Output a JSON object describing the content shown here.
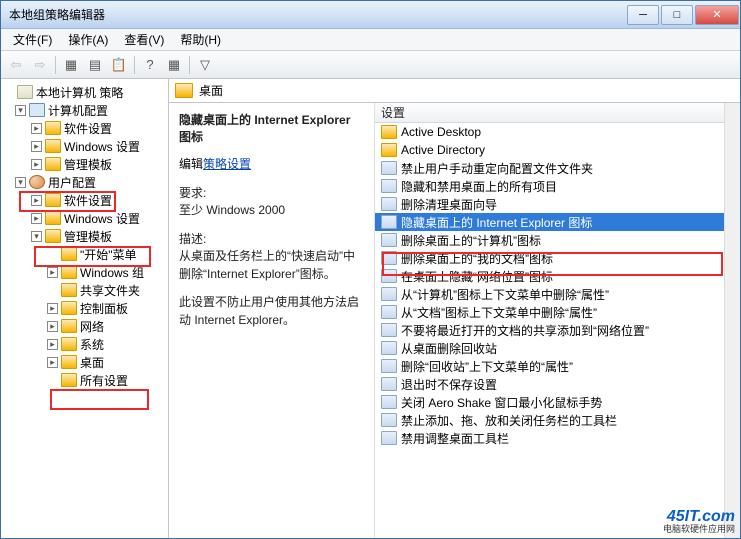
{
  "window": {
    "title": "本地组策略编辑器"
  },
  "menu": {
    "file": "文件(F)",
    "action": "操作(A)",
    "view": "查看(V)",
    "help": "帮助(H)"
  },
  "tree": {
    "root": "本地计算机 策略",
    "comp": "计算机配置",
    "comp_sw": "软件设置",
    "comp_win": "Windows 设置",
    "comp_admin": "管理模板",
    "user": "用户配置",
    "user_sw": "软件设置",
    "user_win": "Windows 设置",
    "user_admin": "管理模板",
    "start_menu": "\"开始\"菜单",
    "win_comp": "Windows 组",
    "shared": "共享文件夹",
    "ctrl_panel": "控制面板",
    "network": "网络",
    "system": "系统",
    "desktop": "桌面",
    "all": "所有设置"
  },
  "content": {
    "header": "桌面",
    "heading": "隐藏桌面上的 Internet Explorer 图标",
    "edit": "编辑",
    "policy_link": "策略设置",
    "req_label": "要求:",
    "req_val": "至少 Windows 2000",
    "desc_label": "描述:",
    "desc_1": "从桌面及任务栏上的“快速启动”中删除“Internet Explorer”图标。",
    "desc_2": "此设置不防止用户使用其他方法启动 Internet Explorer。"
  },
  "list": {
    "col": "设置",
    "items": [
      {
        "label": "Active Desktop",
        "type": "folder"
      },
      {
        "label": "Active Directory",
        "type": "folder"
      },
      {
        "label": "禁止用户手动重定向配置文件文件夹",
        "type": "setting"
      },
      {
        "label": "隐藏和禁用桌面上的所有项目",
        "type": "setting"
      },
      {
        "label": "删除清理桌面向导",
        "type": "setting"
      },
      {
        "label": "隐藏桌面上的 Internet Explorer 图标",
        "type": "setting",
        "selected": true
      },
      {
        "label": "删除桌面上的“计算机”图标",
        "type": "setting"
      },
      {
        "label": "删除桌面上的“我的文档”图标",
        "type": "setting"
      },
      {
        "label": "在桌面上隐藏“网络位置”图标",
        "type": "setting"
      },
      {
        "label": "从“计算机”图标上下文菜单中删除“属性”",
        "type": "setting"
      },
      {
        "label": "从“文档”图标上下文菜单中删除“属性”",
        "type": "setting"
      },
      {
        "label": "不要将最近打开的文档的共享添加到“网络位置”",
        "type": "setting"
      },
      {
        "label": "从桌面删除回收站",
        "type": "setting"
      },
      {
        "label": "删除“回收站”上下文菜单的“属性”",
        "type": "setting"
      },
      {
        "label": "退出时不保存设置",
        "type": "setting"
      },
      {
        "label": "关闭 Aero Shake 窗口最小化鼠标手势",
        "type": "setting"
      },
      {
        "label": "禁止添加、拖、放和关闭任务栏的工具栏",
        "type": "setting"
      },
      {
        "label": "禁用调整桌面工具栏",
        "type": "setting"
      }
    ]
  },
  "watermark": {
    "main": "45IT.com",
    "sub": "电脑软硬件应用网"
  }
}
